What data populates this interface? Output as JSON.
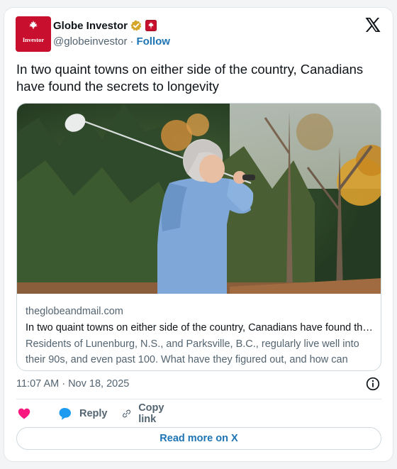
{
  "account": {
    "display_name": "Globe Investor",
    "avatar_text": "Investor",
    "handle": "@globeinvestor",
    "separator": "·",
    "follow_label": "Follow",
    "verified_badge_icon": "gold-verified-badge-icon",
    "affiliate_badge_icon": "maple-leaf-affiliate-icon"
  },
  "tweet": {
    "text": "In two quaint towns on either side of the country, Canadians have found the secrets to longevity"
  },
  "link_card": {
    "domain": "theglobeandmail.com",
    "title": "In two quaint towns on either side of the country, Canadians have found the secrets to longevity",
    "description": "Residents of Lunenburg, N.S., and Parksville, B.C., regularly live well into their 90s, and even past 100. What have they figured out, and how can others learn from them?",
    "image_icon": "photo-elderly-woman-golfing"
  },
  "meta": {
    "timestamp": "11:07 AM · Nov 18, 2025"
  },
  "actions": {
    "like_label": "",
    "reply_label": "Reply",
    "copy_link_label": "Copy link"
  },
  "footer": {
    "read_more_label": "Read more on X"
  },
  "colors": {
    "brand_red": "#c8102e",
    "link_blue": "#1d74b5",
    "like_pink": "#f91880",
    "reply_blue": "#1d9bf0",
    "muted_text": "#536471"
  }
}
